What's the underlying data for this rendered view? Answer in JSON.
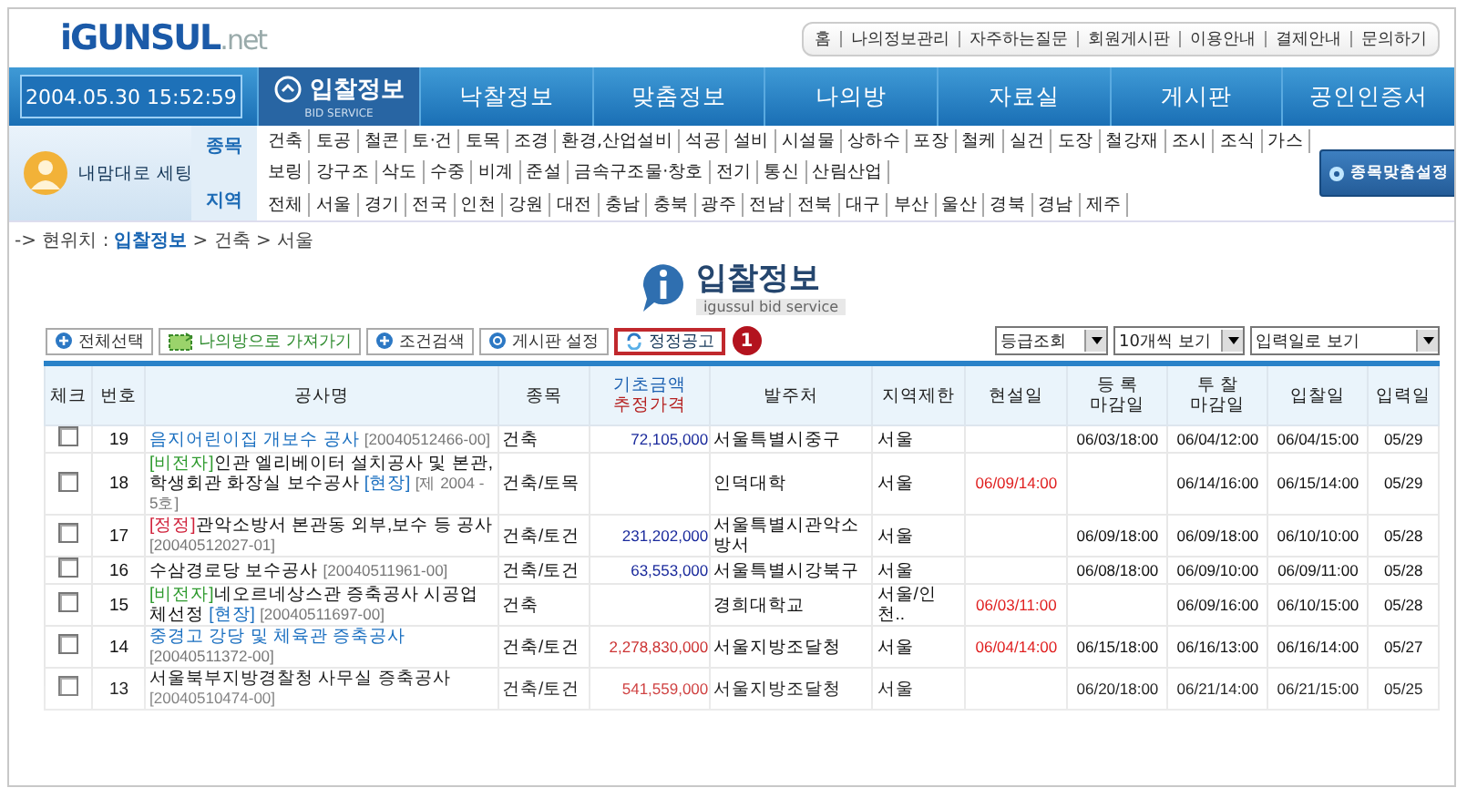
{
  "logo": {
    "brand": "iGUNSUL",
    ".net": ".net"
  },
  "top_links": [
    "홈",
    "나의정보관리",
    "자주하는질문",
    "회원게시판",
    "이용안내",
    "결제안내",
    "문의하기"
  ],
  "clock": "2004.05.30 15:52:59",
  "nav": [
    {
      "label": "입찰정보",
      "sub": "BID SERVICE",
      "selected": true
    },
    {
      "label": "낙찰정보",
      "selected": false
    },
    {
      "label": "맞춤정보",
      "selected": false
    },
    {
      "label": "나의방",
      "selected": false
    },
    {
      "label": "자료실",
      "selected": false
    },
    {
      "label": "게시판",
      "selected": false
    },
    {
      "label": "공인인증서",
      "selected": false
    }
  ],
  "my_setting": "내맘대로 세팅",
  "category_groups": [
    {
      "label": "종목",
      "items": [
        "건축",
        "토공",
        "철콘",
        "토·건",
        "토목",
        "조경",
        "환경,산업설비",
        "석공",
        "설비",
        "시설물",
        "상하수",
        "포장",
        "철케",
        "실건",
        "도장",
        "철강재",
        "조시",
        "조식",
        "가스",
        "보링",
        "강구조",
        "삭도",
        "수중",
        "비계",
        "준설",
        "금속구조물·창호",
        "전기",
        "통신",
        "산림산업"
      ]
    },
    {
      "label": "지역",
      "items": [
        "전체",
        "서울",
        "경기",
        "전국",
        "인천",
        "강원",
        "대전",
        "충남",
        "충북",
        "광주",
        "전남",
        "전북",
        "대구",
        "부산",
        "울산",
        "경북",
        "경남",
        "제주"
      ]
    }
  ],
  "custom_button": "종목맞춤설정",
  "breadcrumb": {
    "prefix": "-> 현위치 :",
    "current": "입찰정보",
    "rest": "> 건축 > 서울"
  },
  "page_title": {
    "title": "입찰정보",
    "subtitle": "igussul bid service"
  },
  "toolbar": [
    {
      "label": "전체선택",
      "kind": "plus",
      "highlighted": false
    },
    {
      "label": "나의방으로 가져가기",
      "kind": "import",
      "highlighted": false
    },
    {
      "label": "조건검색",
      "kind": "plus",
      "highlighted": false
    },
    {
      "label": "게시판 설정",
      "kind": "gear",
      "highlighted": false
    },
    {
      "label": "정정공고",
      "kind": "refresh",
      "highlighted": true
    }
  ],
  "callout": "1",
  "selects": [
    "등급조회",
    "10개씩 보기",
    "입력일로 보기"
  ],
  "table": {
    "columns": [
      "체크",
      "번호",
      "공사명",
      "종목",
      {
        "base": "기초금액",
        "estimate": "추정가격"
      },
      "발주처",
      "지역제한",
      "현설일",
      "등 록\n마감일",
      "투 찰\n마감일",
      "입찰일",
      "입력일"
    ],
    "rows": [
      {
        "checked": false,
        "no": "19",
        "title": "음지어린이집 개보수 공사",
        "link": true,
        "code": "[20040512466-00]",
        "type": "건축",
        "amount": "72,105,000",
        "estimated": false,
        "client": "서울특별시중구",
        "region": "서울",
        "reg_deadline": "06/03/18:00",
        "bid_deadline": "06/04/12:00",
        "bid_date": "06/04/15:00",
        "entry_date": "05/29"
      },
      {
        "checked": false,
        "no": "18",
        "prefix": {
          "kind": "non-electronic",
          "text": "[비전자]"
        },
        "title": "인관 엘리베이터 설치공사 및 본관, 학생회관 화장실 보수공사",
        "link": false,
        "site": "[현장]",
        "code": "[제 2004 - 5호]",
        "type": "건축/토목",
        "client": "인덕대학",
        "region": "서울",
        "briefing": "06/09/14:00",
        "bid_deadline": "06/14/16:00",
        "bid_date": "06/15/14:00",
        "entry_date": "05/29"
      },
      {
        "checked": false,
        "no": "17",
        "prefix": {
          "kind": "correction",
          "text": "[정정]"
        },
        "title": "관악소방서 본관동 외부,보수 등 공사",
        "link": false,
        "code": "[20040512027-01]",
        "type": "건축/토건",
        "amount": "231,202,000",
        "estimated": false,
        "client": "서울특별시관악소방서",
        "region": "서울",
        "reg_deadline": "06/09/18:00",
        "bid_deadline": "06/09/18:00",
        "bid_date": "06/10/10:00",
        "entry_date": "05/28"
      },
      {
        "checked": false,
        "no": "16",
        "title": "수삼경로당 보수공사",
        "link": false,
        "code": "[20040511961-00]",
        "type": "건축/토건",
        "amount": "63,553,000",
        "estimated": false,
        "client": "서울특별시강북구",
        "region": "서울",
        "reg_deadline": "06/08/18:00",
        "bid_deadline": "06/09/10:00",
        "bid_date": "06/09/11:00",
        "entry_date": "05/28"
      },
      {
        "checked": false,
        "no": "15",
        "prefix": {
          "kind": "non-electronic",
          "text": "[비전자]"
        },
        "title": "네오르네상스관 증축공사 시공업체선정",
        "link": false,
        "site": "[현장]",
        "code": "[20040511697-00]",
        "type": "건축",
        "client": "경희대학교",
        "region": "서울/인천..",
        "briefing": "06/03/11:00",
        "bid_deadline": "06/09/16:00",
        "bid_date": "06/10/15:00",
        "entry_date": "05/28"
      },
      {
        "checked": false,
        "no": "14",
        "title": "중경고 강당 및 체육관 증축공사",
        "link": true,
        "code": "[20040511372-00]",
        "type": "건축/토건",
        "amount": "2,278,830,000",
        "estimated": true,
        "client": "서울지방조달청",
        "region": "서울",
        "briefing": "06/04/14:00",
        "reg_deadline": "06/15/18:00",
        "bid_deadline": "06/16/13:00",
        "bid_date": "06/16/14:00",
        "entry_date": "05/27"
      },
      {
        "checked": false,
        "no": "13",
        "title": "서울북부지방경찰청 사무실 증축공사",
        "link": false,
        "code": "[20040510474-00]",
        "type": "건축/토건",
        "amount": "541,559,000",
        "estimated": true,
        "client": "서울지방조달청",
        "region": "서울",
        "reg_deadline": "06/20/18:00",
        "bid_deadline": "06/21/14:00",
        "bid_date": "06/21/15:00",
        "entry_date": "05/25"
      }
    ]
  }
}
